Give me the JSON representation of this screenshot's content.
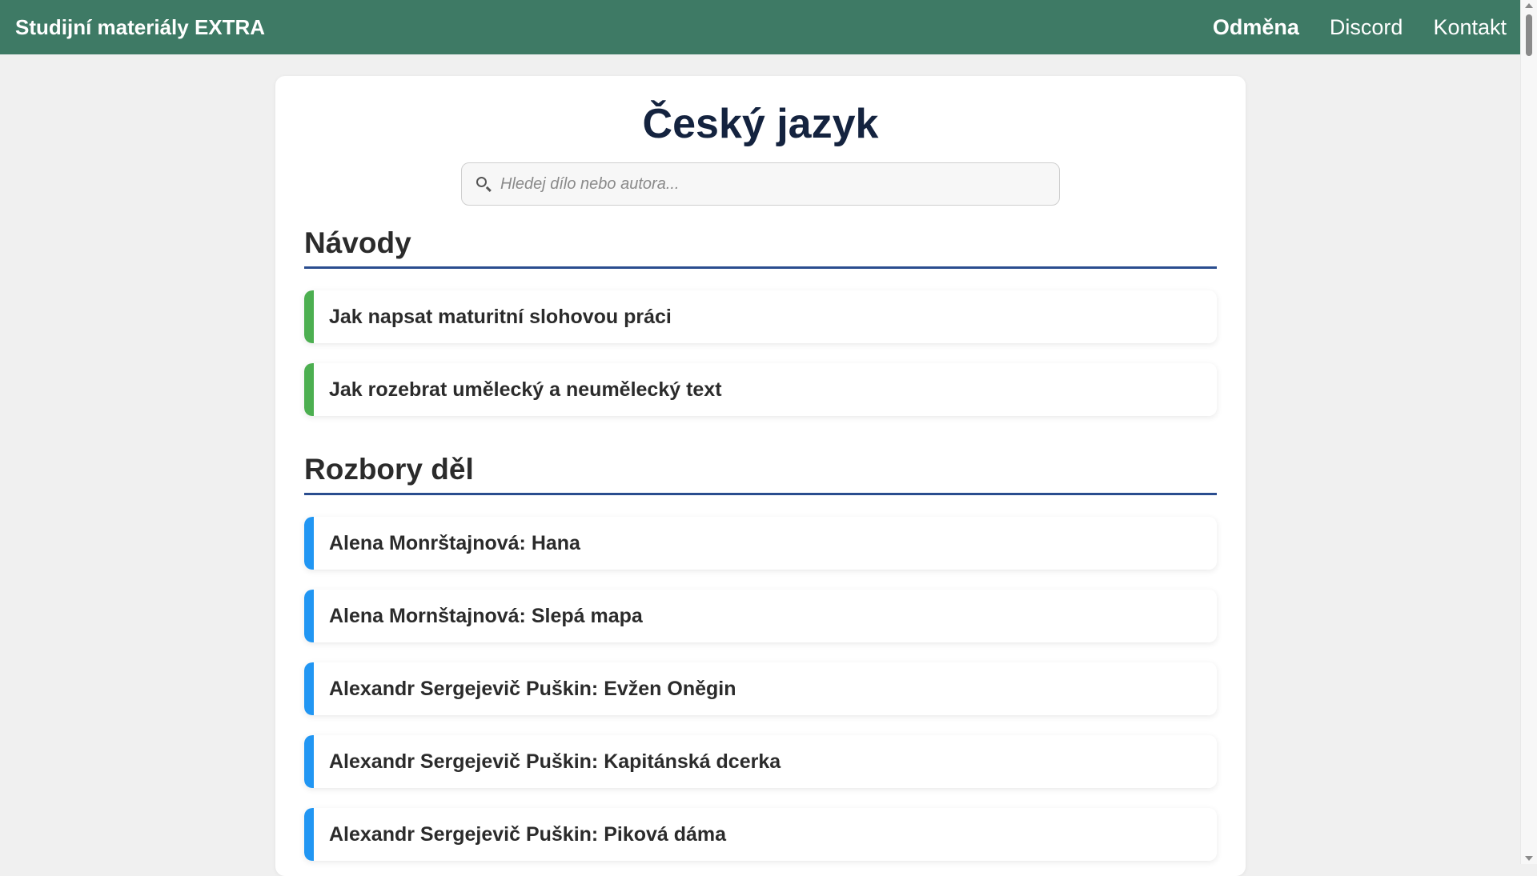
{
  "header": {
    "brand": "Studijní materiály EXTRA",
    "nav": [
      {
        "label": "Odměna",
        "bold": true
      },
      {
        "label": "Discord",
        "bold": false
      },
      {
        "label": "Kontakt",
        "bold": false
      }
    ],
    "color": "#3e7a65"
  },
  "main": {
    "title": "Český jazyk",
    "search": {
      "placeholder": "Hledej dílo nebo autora...",
      "value": ""
    },
    "sections": [
      {
        "heading": "Návody",
        "accent": "#4caf50",
        "items": [
          "Jak napsat maturitní slohovou práci",
          "Jak rozebrat umělecký a neumělecký text"
        ]
      },
      {
        "heading": "Rozbory děl",
        "accent": "#2196f3",
        "items": [
          "Alena Monrštajnová: Hana",
          "Alena Mornštajnová: Slepá mapa",
          "Alexandr Sergejevič Puškin: Evžen Oněgin",
          "Alexandr Sergejevič Puškin: Kapitánská dcerka",
          "Alexandr Sergejevič Puškin: Piková dáma"
        ]
      }
    ]
  }
}
